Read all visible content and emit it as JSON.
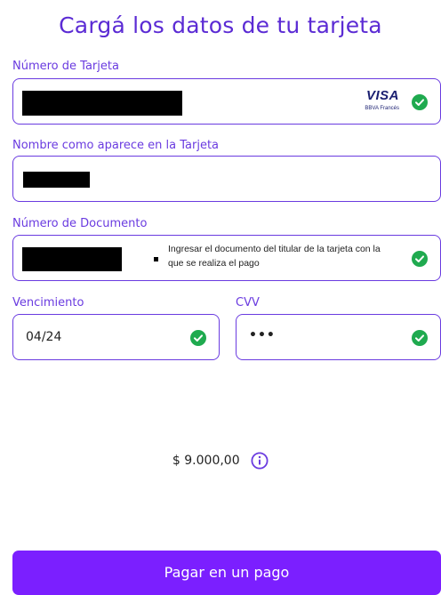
{
  "header": {
    "title": "Cargá los datos de tu tarjeta"
  },
  "card_number": {
    "label": "Número de Tarjeta",
    "brand": "VISA",
    "issuer": "BBVA Francés",
    "valid": true
  },
  "cardholder": {
    "label": "Nombre como aparece en la Tarjeta"
  },
  "document": {
    "label": "Número de Documento",
    "hint": "Ingresar el documento del titular de la tarjeta con la que se realiza el pago",
    "valid": true
  },
  "expiry": {
    "label": "Vencimiento",
    "value": "04/24",
    "valid": true
  },
  "cvv": {
    "label": "CVV",
    "value": "•••",
    "valid": true
  },
  "summary": {
    "amount": "$ 9.000,00"
  },
  "actions": {
    "pay_label": "Pagar en un pago"
  },
  "colors": {
    "accent": "#6a3be0",
    "button": "#7b1fff",
    "success": "#1faa4f"
  },
  "icons": {
    "valid": "check-circle-icon",
    "info": "info-icon"
  }
}
